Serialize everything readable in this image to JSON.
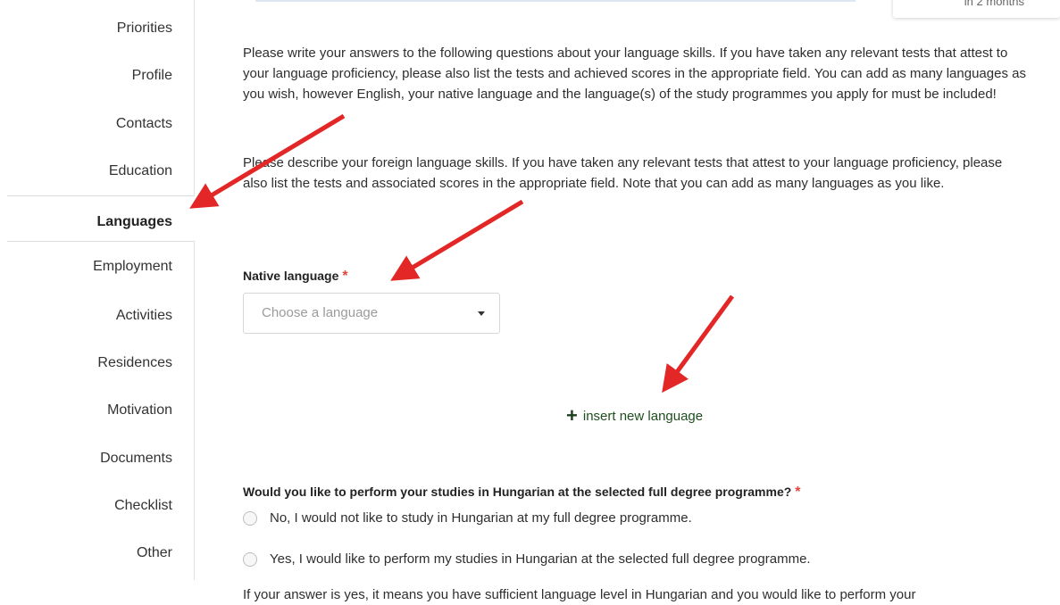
{
  "header": {
    "deadline_text": "in 2 months"
  },
  "sidebar": {
    "items": [
      {
        "label": "Priorities"
      },
      {
        "label": "Profile"
      },
      {
        "label": "Contacts"
      },
      {
        "label": "Education"
      },
      {
        "label": "Languages",
        "active": true
      },
      {
        "label": "Employment"
      },
      {
        "label": "Activities"
      },
      {
        "label": "Residences"
      },
      {
        "label": "Motivation"
      },
      {
        "label": "Documents"
      },
      {
        "label": "Checklist"
      },
      {
        "label": "Other"
      }
    ]
  },
  "main": {
    "intro_1": "Please write your answers to the following questions about your language skills. If you have taken any relevant tests that attest to your language proficiency, please also list the tests and achieved scores in the appropriate field. You can add as many languages as you wish, however English, your native language and the language(s) of the study programmes you apply for must be included!",
    "intro_2": "Please describe your foreign language skills. If you have taken any relevant tests that attest to your language proficiency, please also list the tests and associated scores in the appropriate field. Note that you can add as many languages as you like.",
    "native_language": {
      "label": "Native language",
      "required_mark": "*",
      "placeholder": "Choose a language"
    },
    "insert_language": {
      "icon": "plus-icon",
      "label": "insert new language"
    },
    "hungarian_question": {
      "label": "Would you like to perform your studies in Hungarian at the selected full degree programme?",
      "required_mark": "*",
      "options": [
        "No, I would not like to study in Hungarian at my full degree programme.",
        "Yes, I would like to perform my studies in Hungarian at the selected full degree programme."
      ]
    },
    "followup_text": "If your answer is yes, it means you have sufficient language level in Hungarian and you would like to perform your"
  },
  "colors": {
    "required": "#e5453d",
    "arrow": "#e32626",
    "link": "#1f4e1f"
  }
}
